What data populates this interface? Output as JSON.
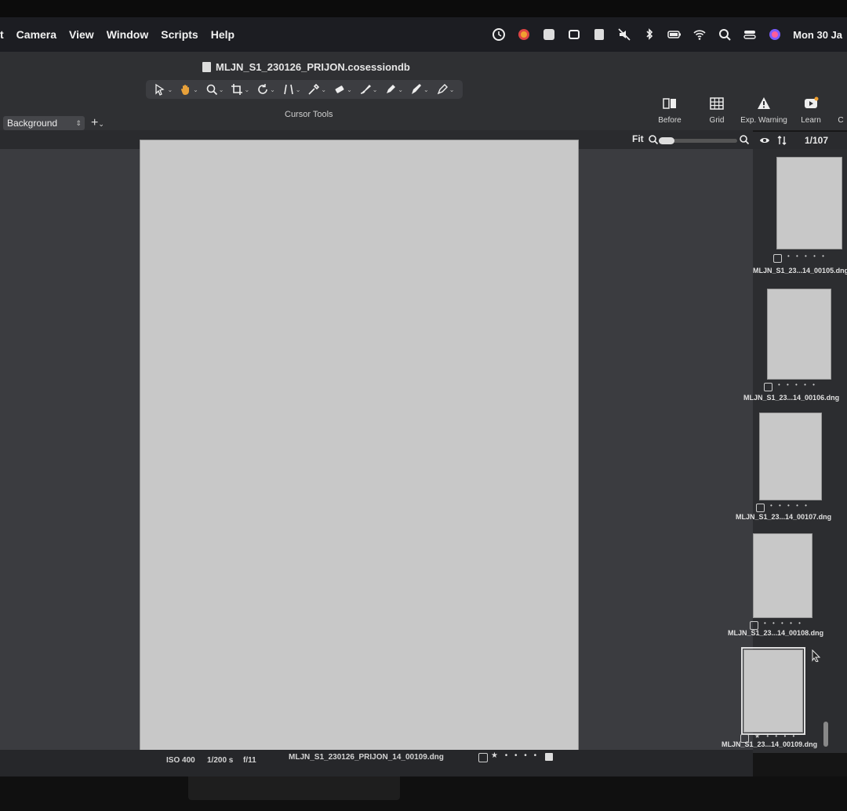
{
  "menubar": {
    "items": [
      "t",
      "Camera",
      "View",
      "Window",
      "Scripts",
      "Help"
    ],
    "clock": "Mon 30 Ja"
  },
  "document": {
    "title": "MLJN_S1_230126_PRIJON.cosessiondb"
  },
  "toolbar": {
    "tools_label": "Cursor Tools",
    "tools": [
      "select-arrow-icon",
      "hand-icon",
      "zoom-icon",
      "crop-icon",
      "rotate-icon",
      "keystone-icon",
      "picker-icon",
      "eraser-icon",
      "brush-icon",
      "pen-icon",
      "gradient-icon",
      "stylus-icon"
    ],
    "right": [
      {
        "label": "Before",
        "icon": "before-after-icon"
      },
      {
        "label": "Grid",
        "icon": "grid-icon"
      },
      {
        "label": "Exp. Warning",
        "icon": "warning-icon"
      },
      {
        "label": "Learn",
        "icon": "learn-icon"
      },
      {
        "label": "C",
        "icon": ""
      }
    ]
  },
  "layers": {
    "selected": "Background",
    "add": "+"
  },
  "viewer": {
    "zoom_label": "Fit",
    "footer": {
      "iso": "ISO 400",
      "shutter": "1/200 s",
      "aperture": "f/11",
      "filename": "MLJN_S1_230126_PRIJON_14_00109.dng",
      "stars": "★ • • • •"
    }
  },
  "browser": {
    "count": "1/107",
    "thumbnails": [
      {
        "label": "MLJN_S1_23...14_00105.dng",
        "stars": "• • • • •"
      },
      {
        "label": "MLJN_S1_23...14_00106.dng",
        "stars": "• • • • •"
      },
      {
        "label": "MLJN_S1_23...14_00107.dng",
        "stars": "• • • • •"
      },
      {
        "label": "MLJN_S1_23...14_00108.dng",
        "stars": "• • • • •"
      },
      {
        "label": "MLJN_S1_23...14_00109.dng",
        "stars": "★ • • • •"
      }
    ]
  }
}
